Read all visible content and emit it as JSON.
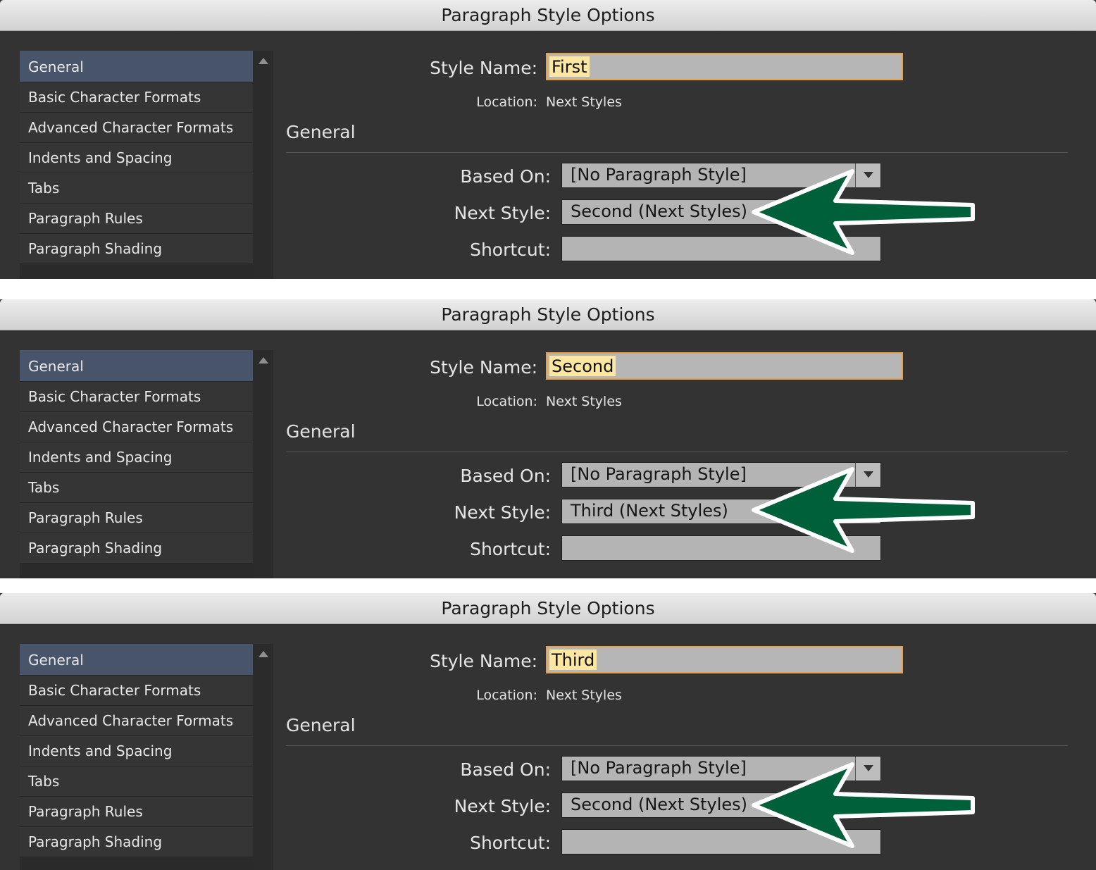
{
  "dialogs": [
    {
      "title": "Paragraph Style Options",
      "categories": [
        "General",
        "Basic Character Formats",
        "Advanced Character Formats",
        "Indents and Spacing",
        "Tabs",
        "Paragraph Rules",
        "Paragraph Shading"
      ],
      "style_name_label": "Style Name:",
      "style_name": "First",
      "location_label": "Location:",
      "location": "Next Styles",
      "section": "General",
      "based_on_label": "Based On:",
      "based_on": "[No Paragraph Style]",
      "next_style_label": "Next Style:",
      "next_style": "Second (Next Styles)",
      "shortcut_label": "Shortcut:",
      "shortcut": ""
    },
    {
      "title": "Paragraph Style Options",
      "categories": [
        "General",
        "Basic Character Formats",
        "Advanced Character Formats",
        "Indents and Spacing",
        "Tabs",
        "Paragraph Rules",
        "Paragraph Shading"
      ],
      "style_name_label": "Style Name:",
      "style_name": "Second",
      "location_label": "Location:",
      "location": "Next Styles",
      "section": "General",
      "based_on_label": "Based On:",
      "based_on": "[No Paragraph Style]",
      "next_style_label": "Next Style:",
      "next_style": "Third (Next Styles)",
      "shortcut_label": "Shortcut:",
      "shortcut": ""
    },
    {
      "title": "Paragraph Style Options",
      "categories": [
        "General",
        "Basic Character Formats",
        "Advanced Character Formats",
        "Indents and Spacing",
        "Tabs",
        "Paragraph Rules",
        "Paragraph Shading"
      ],
      "style_name_label": "Style Name:",
      "style_name": "Third",
      "location_label": "Location:",
      "location": "Next Styles",
      "section": "General",
      "based_on_label": "Based On:",
      "based_on": "[No Paragraph Style]",
      "next_style_label": "Next Style:",
      "next_style": "Second (Next Styles)",
      "shortcut_label": "Shortcut:",
      "shortcut": ""
    }
  ],
  "colors": {
    "dialog_bg": "#333333",
    "selected_category": "#485469",
    "focus_border": "#e8a24a",
    "text_highlight": "#fbe6a2",
    "annotation_arrow": "#00603a"
  },
  "icons": {
    "annotation": "green-arrow-icon",
    "dropdown": "chevron-down-icon",
    "scroll": "scroll-up-icon"
  }
}
